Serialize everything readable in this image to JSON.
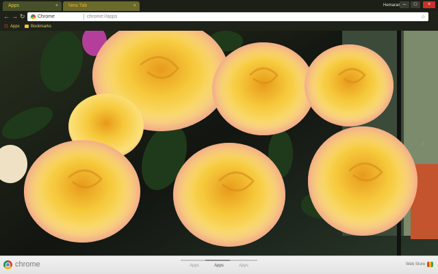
{
  "tabs": [
    {
      "label": "Apps",
      "close_glyph": "×"
    },
    {
      "label": "New Tab",
      "close_glyph": "×"
    }
  ],
  "profile_name": "Hemaram",
  "window_controls": {
    "minimize": "–",
    "maximize": "□",
    "close": "×"
  },
  "nav": {
    "back": "←",
    "forward": "→",
    "reload": "↻"
  },
  "omnibox": {
    "chip_label": "Chrome",
    "url": "chrome://apps",
    "star": "☆"
  },
  "bookmarks": [
    {
      "label": "Apps",
      "icon": "apps-grid-icon"
    },
    {
      "label": "Bookmarks",
      "icon": "folder-icon"
    }
  ],
  "next_page_glyph": "›",
  "bottom": {
    "logo_text": "chrome",
    "pages": [
      "Apps",
      "Apps",
      "Apps"
    ],
    "active_page": 1,
    "store_label": "Web Store"
  },
  "colors": {
    "accent_tab_text": "#f5a623",
    "close_button": "#c9312b",
    "rose_yellow": "#f5c93a"
  }
}
